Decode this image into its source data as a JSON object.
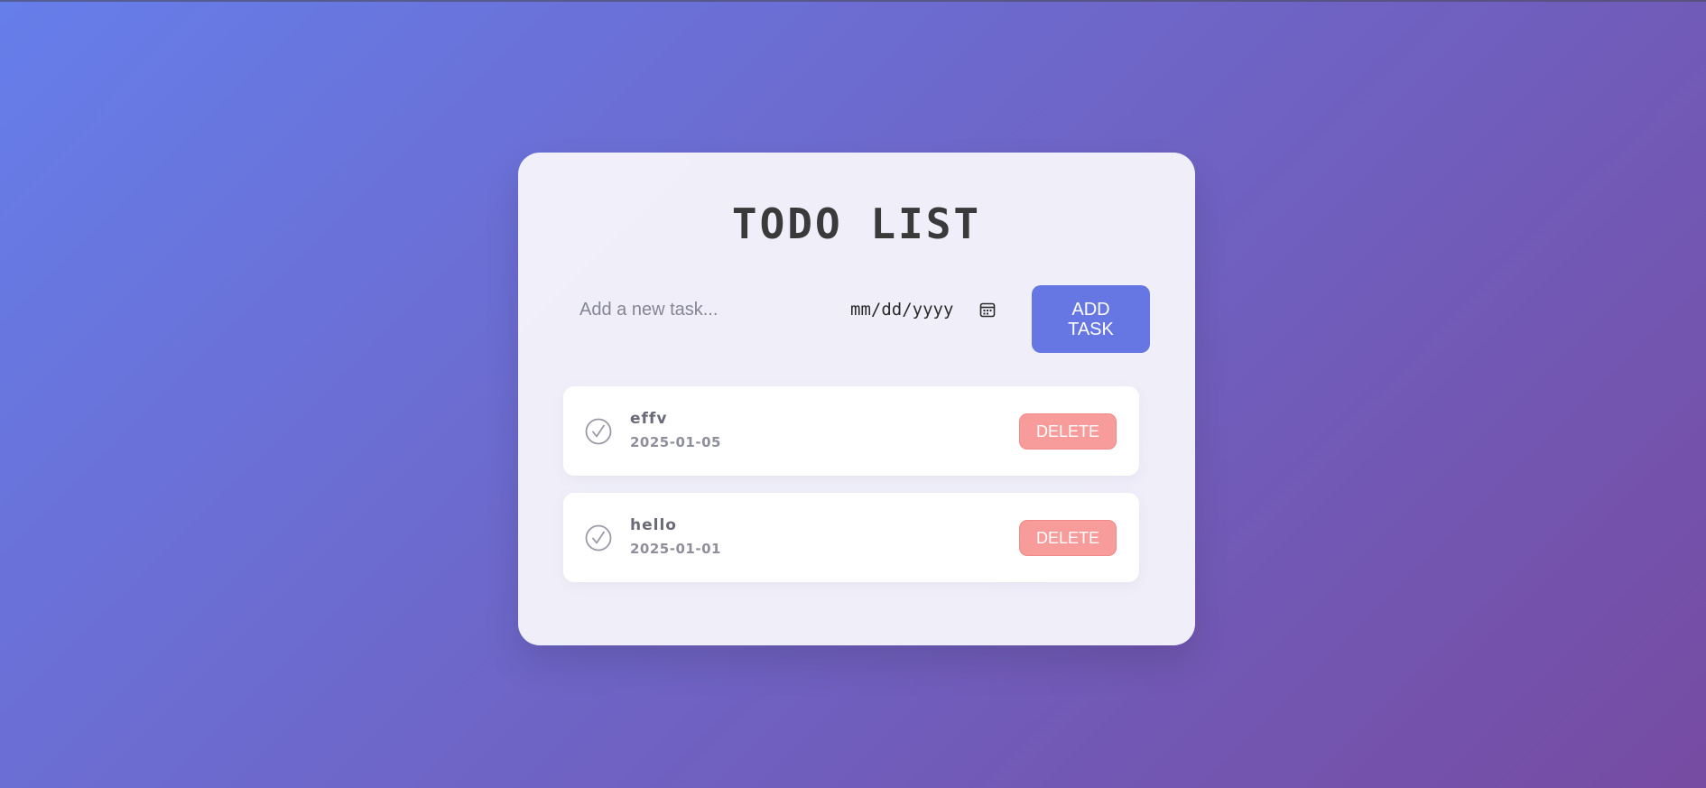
{
  "app": {
    "title": "TODO LIST"
  },
  "form": {
    "task_placeholder": "Add a new task...",
    "task_value": "",
    "date_placeholder": "mm/dd/yyyy",
    "add_label": "ADD TASK"
  },
  "tasks": [
    {
      "title": "effv",
      "date": "2025-01-05",
      "delete_label": "DELETE"
    },
    {
      "title": "hello",
      "date": "2025-01-01",
      "delete_label": "DELETE"
    }
  ],
  "icons": {
    "date": "calendar-icon",
    "task_status": "check-circle-icon"
  },
  "colors": {
    "background_start": "#667eea",
    "background_end": "#764ba2",
    "add_button": "#6677e3",
    "delete_button": "#f79b9b",
    "card": "#f6f5fb"
  }
}
